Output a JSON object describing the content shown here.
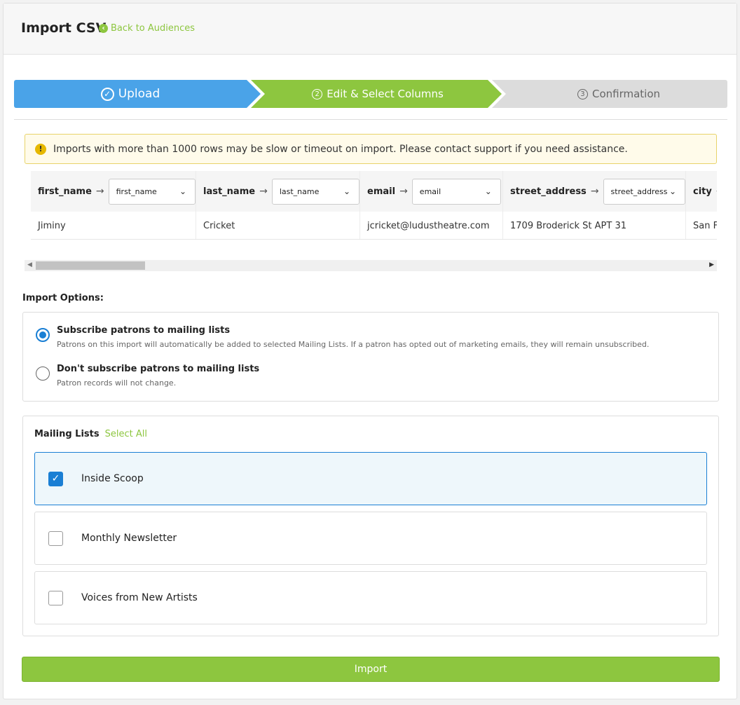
{
  "header": {
    "title": "Import CSV",
    "back_link": "Back to Audiences"
  },
  "steps": [
    {
      "number": "",
      "label": "Upload",
      "state": "complete"
    },
    {
      "number": "2",
      "label": "Edit & Select Columns",
      "state": "active"
    },
    {
      "number": "3",
      "label": "Confirmation",
      "state": "pending"
    }
  ],
  "alert": {
    "icon": "!",
    "text": "Imports with more than 1000 rows may be slow or timeout on import. Please contact support if you need assistance."
  },
  "table": {
    "columns": [
      {
        "header": "first_name",
        "selected": "first_name"
      },
      {
        "header": "last_name",
        "selected": "last_name"
      },
      {
        "header": "email",
        "selected": "email"
      },
      {
        "header": "street_address",
        "selected": "street_address"
      },
      {
        "header": "city",
        "selected": ""
      }
    ],
    "row": [
      "Jiminy",
      "Cricket",
      "jcricket@ludustheatre.com",
      "1709 Broderick St APT 31",
      "San Francisco"
    ]
  },
  "import_options": {
    "title": "Import Options:",
    "options": [
      {
        "label": "Subscribe patrons to mailing lists",
        "description": "Patrons on this import will automatically be added to selected Mailing Lists. If a patron has opted out of marketing emails, they will remain unsubscribed.",
        "selected": true
      },
      {
        "label": "Don't subscribe patrons to mailing lists",
        "description": "Patron records will not change.",
        "selected": false
      }
    ]
  },
  "mailing_lists": {
    "title": "Mailing Lists",
    "select_all": "Select All",
    "items": [
      {
        "label": "Inside Scoop",
        "checked": true
      },
      {
        "label": "Monthly Newsletter",
        "checked": false
      },
      {
        "label": "Voices from New Artists",
        "checked": false
      }
    ]
  },
  "import_button": "Import",
  "colors": {
    "green": "#8dc63f",
    "blue": "#4aa3e8",
    "check_blue": "#1a7fd4"
  }
}
